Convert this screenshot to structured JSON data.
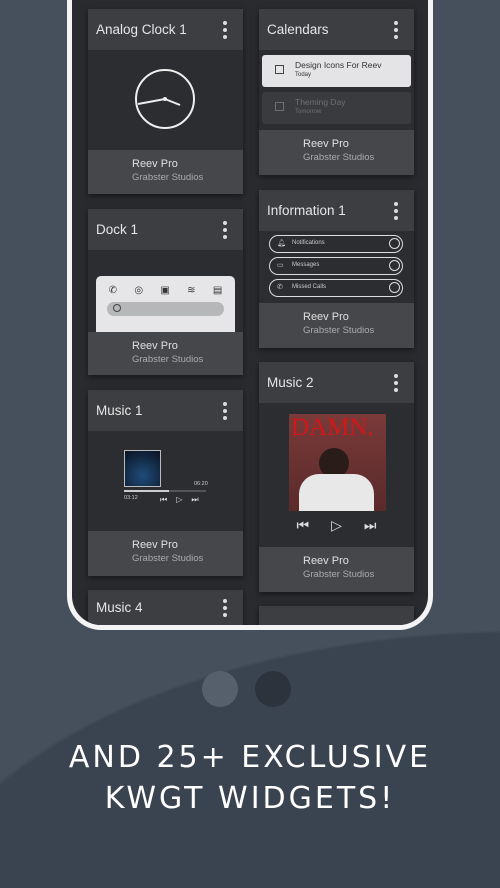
{
  "widgets": {
    "analog_clock": {
      "title": "Analog Clock 1",
      "name": "Reev Pro",
      "author": "Grabster Studios"
    },
    "calendars": {
      "title": "Calendars",
      "name": "Reev Pro",
      "author": "Grabster Studios",
      "events": [
        {
          "title": "Design Icons For Reev",
          "when": "Today"
        },
        {
          "title": "Theming Day",
          "when": "Tomorrow"
        }
      ]
    },
    "dock": {
      "title": "Dock 1",
      "name": "Reev Pro",
      "author": "Grabster Studios"
    },
    "information": {
      "title": "Information 1",
      "name": "Reev Pro",
      "author": "Grabster Studios",
      "rows": [
        "Notifications",
        "Messages",
        "Missed Calls"
      ],
      "counts": [
        "0",
        "0",
        "0"
      ]
    },
    "music1": {
      "title": "Music 1",
      "name": "Reev Pro",
      "author": "Grabster Studios",
      "elapsed": "03:12",
      "duration": "06:20",
      "progress": 0.55
    },
    "music2": {
      "title": "Music 2",
      "name": "Reev Pro",
      "author": "Grabster Studios",
      "album_title": "DAMN."
    },
    "music4": {
      "title": "Music 4"
    }
  },
  "pager": {
    "pages": 2,
    "active": 1
  },
  "tagline": {
    "line1": "AND 25+ EXCLUSIVE",
    "line2": "KWGT WIDGETS!"
  },
  "colors": {
    "background": "#46505c",
    "card": "#46474b",
    "card_body": "#2c2d31"
  }
}
